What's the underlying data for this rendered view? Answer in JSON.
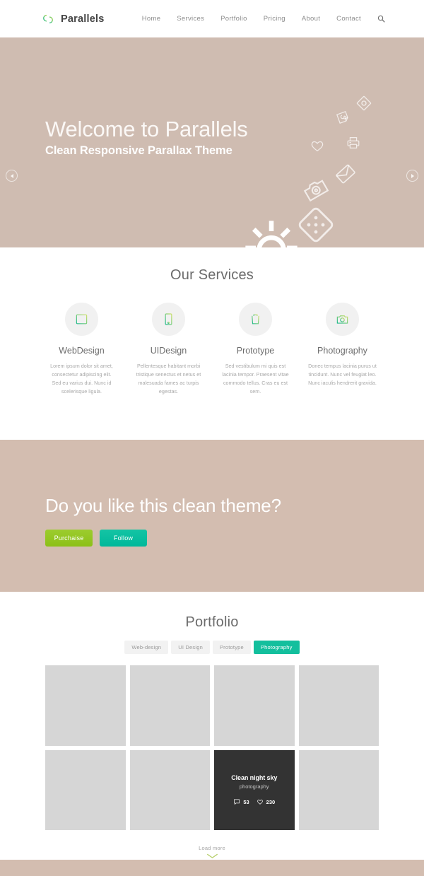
{
  "header": {
    "brand": "Parallels",
    "logo_icon": "interlocking-rings-logo",
    "nav": [
      {
        "label": "Home"
      },
      {
        "label": "Services"
      },
      {
        "label": "Portfolio"
      },
      {
        "label": "Pricing"
      },
      {
        "label": "About"
      },
      {
        "label": "Contact"
      }
    ],
    "search_icon": "search-icon"
  },
  "hero": {
    "title": "Welcome to Parallels",
    "subtitle": "Clean Responsive Parallax Theme",
    "prev_icon": "chevron-left-icon",
    "next_icon": "chevron-right-icon",
    "background_color": "#cfbcb1",
    "decor_icons": [
      "diamond-photo-icon",
      "spiral-sticker-icon",
      "heart-icon",
      "printer-icon",
      "envelope-icon",
      "map-pin-photo-icon",
      "dice-diamond-icon",
      "sun-brightness-icon"
    ]
  },
  "services": {
    "title": "Our Services",
    "items": [
      {
        "icon": "browser-window-icon",
        "name": "WebDesign",
        "desc": "Lorem ipsum dolor sit amet, consectetur adipiscing elit. Sed eu varius dui. Nunc id scelerisque ligula."
      },
      {
        "icon": "mobile-phone-icon",
        "name": "UIDesign",
        "desc": "Pellentesque habitant morbi tristique senectus et netus et malesuada fames ac turpis egestas."
      },
      {
        "icon": "trash-bin-icon",
        "name": "Prototype",
        "desc": "Sed vestibulum mi quis est lacinia tempor. Praesent vitae commodo tellus. Cras eu est sem."
      },
      {
        "icon": "camera-icon",
        "name": "Photography",
        "desc": "Donec tempus lacinia purus ut tincidunt. Nunc vel feugiat leo. Nunc iaculis hendrerit gravida."
      }
    ]
  },
  "cta": {
    "title": "Do you like this clean theme?",
    "purchase_label": "Purchaise",
    "follow_label": "Follow",
    "purchase_color": "#9ccc2e",
    "follow_color": "#00b89a",
    "background_color": "#d3bdb0"
  },
  "portfolio": {
    "title": "Portfolio",
    "filters": [
      {
        "label": "Web-design",
        "active": false
      },
      {
        "label": "UI Design",
        "active": false
      },
      {
        "label": "Prototype",
        "active": false
      },
      {
        "label": "Photography",
        "active": true
      }
    ],
    "active_filter_color": "#13bf9d",
    "tiles": [
      {
        "hovered": false
      },
      {
        "hovered": false
      },
      {
        "hovered": false
      },
      {
        "hovered": false
      },
      {
        "hovered": false
      },
      {
        "hovered": false
      },
      {
        "hovered": true,
        "title": "Clean night sky",
        "category": "photography",
        "comments": "53",
        "likes": "230",
        "comment_icon": "comment-icon",
        "like_icon": "heart-icon"
      },
      {
        "hovered": false
      }
    ],
    "load_more_label": "Load more",
    "load_more_icon": "chevron-down-icon"
  },
  "footer": {
    "background_color": "#d3bdb0"
  }
}
